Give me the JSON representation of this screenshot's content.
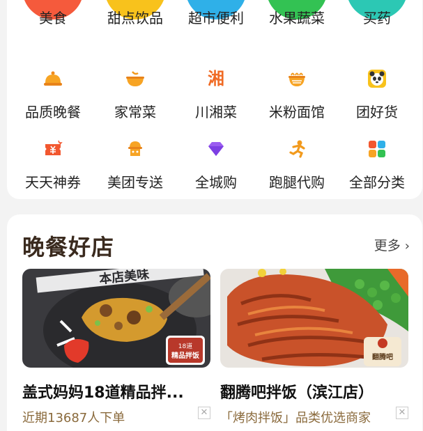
{
  "categories": {
    "row1": [
      {
        "label": "美食",
        "icon": "food-icon",
        "color": "#f55a3c"
      },
      {
        "label": "甜点饮品",
        "icon": "dessert-icon",
        "color": "#f8c21c"
      },
      {
        "label": "超市便利",
        "icon": "supermarket-icon",
        "color": "#2fb0e8"
      },
      {
        "label": "水果蔬菜",
        "icon": "fruit-veg-icon",
        "color": "#33c253"
      },
      {
        "label": "买药",
        "icon": "medicine-icon",
        "color": "#2cc8b4"
      }
    ],
    "row2": [
      {
        "label": "品质晚餐",
        "icon": "dinner-bell-icon"
      },
      {
        "label": "家常菜",
        "icon": "home-dish-icon"
      },
      {
        "label": "川湘菜",
        "icon": "xiang-char-icon",
        "glyph": "湘"
      },
      {
        "label": "米粉面馆",
        "icon": "noodle-bowl-icon"
      },
      {
        "label": "团好货",
        "icon": "panda-icon"
      }
    ],
    "row3": [
      {
        "label": "天天神券",
        "icon": "coupon-icon"
      },
      {
        "label": "美团专送",
        "icon": "delivery-icon"
      },
      {
        "label": "全城购",
        "icon": "diamond-icon"
      },
      {
        "label": "跑腿代购",
        "icon": "runner-icon"
      },
      {
        "label": "全部分类",
        "icon": "grid-icon"
      }
    ]
  },
  "section": {
    "title": "晚餐好店",
    "more_label": "更多"
  },
  "shops": [
    {
      "name": "盖式妈妈18道精品拌...",
      "subtitle": "近期13687人下单",
      "img_banner": "本店美味",
      "badge_line1": "18道",
      "badge_line2": "精品拌饭"
    },
    {
      "name": "翻腾吧拌饭（滨江店）",
      "subtitle": "「烤肉拌饭」品类优选商家",
      "badge_text": "翻腾吧"
    }
  ],
  "close_symbol": "✕"
}
